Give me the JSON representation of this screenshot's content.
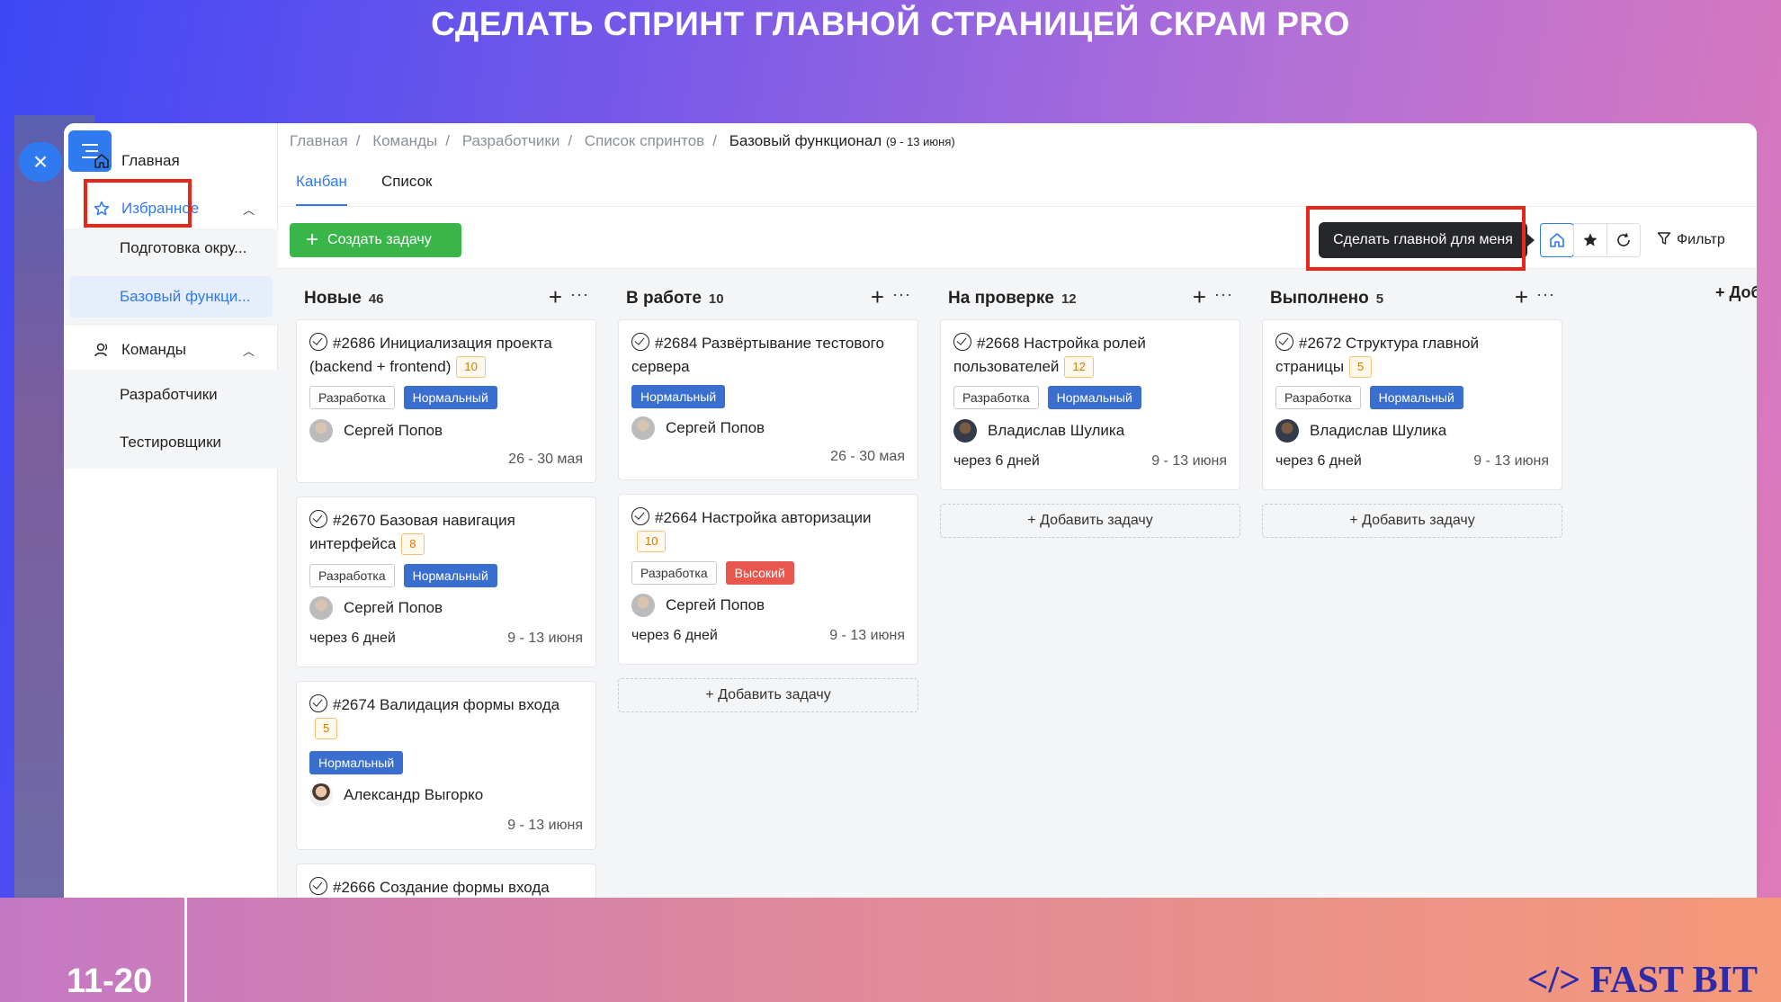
{
  "slide": {
    "title": "СДЕЛАТЬ СПРИНТ ГЛАВНОЙ СТРАНИЦЕЙ СКРАМ PRO",
    "page_number": "11-20",
    "brand": "</> FAST BIT"
  },
  "close_icon": "×",
  "sidebar": {
    "home": "Главная",
    "favorites": "Избранное",
    "favorites_items": [
      "Подготовка окру...",
      "Базовый функци..."
    ],
    "teams": "Команды",
    "teams_items": [
      "Разработчики",
      "Тестировщики"
    ]
  },
  "breadcrumb": {
    "items": [
      "Главная",
      "Команды",
      "Разработчики",
      "Список спринтов"
    ],
    "current": "Базовый функционал",
    "dates": "(9 - 13 июня)"
  },
  "tabs": [
    "Канбан",
    "Список"
  ],
  "toolbar": {
    "create_task": "Создать задачу",
    "tooltip": "Сделать главной для меня",
    "filter": "Фильтр"
  },
  "add_column": "+ Добавить",
  "add_task_label": "+ Добавить задачу",
  "columns": [
    {
      "title": "Новые",
      "count": "46",
      "cards": [
        {
          "id": "#2686",
          "title": "Инициализация проекта (backend + frontend)",
          "points": "10",
          "tags": [
            "Разработка",
            "Нормальный"
          ],
          "assignee": "Сергей Попов",
          "due_rel": "",
          "due": "26 - 30 мая"
        },
        {
          "id": "#2670",
          "title": "Базовая навигация интерфейса",
          "points": "8",
          "tags": [
            "Разработка",
            "Нормальный"
          ],
          "assignee": "Сергей Попов",
          "due_rel": "через 6 дней",
          "due": "9 - 13 июня"
        },
        {
          "id": "#2674",
          "title": "Валидация формы входа",
          "points": "5",
          "tags": [
            "Нормальный"
          ],
          "assignee": "Александр Выгорко",
          "due_rel": "",
          "due": "9 - 13 июня"
        },
        {
          "id": "#2666",
          "title": "Создание формы входа"
        }
      ]
    },
    {
      "title": "В работе",
      "count": "10",
      "cards": [
        {
          "id": "#2684",
          "title": "Развёртывание тестового сервера",
          "tags": [
            "Нормальный"
          ],
          "assignee": "Сергей Попов",
          "due_rel": "",
          "due": "26 - 30 мая"
        },
        {
          "id": "#2664",
          "title": "Настройка авторизации",
          "points": "10",
          "tags": [
            "Разработка",
            "Высокий"
          ],
          "assignee": "Сергей Попов",
          "due_rel": "через 6 дней",
          "due": "9 - 13 июня"
        }
      ]
    },
    {
      "title": "На проверке",
      "count": "12",
      "cards": [
        {
          "id": "#2668",
          "title": "Настройка ролей пользователей",
          "points": "12",
          "tags": [
            "Разработка",
            "Нормальный"
          ],
          "assignee": "Владислав Шулика",
          "due_rel": "через 6 дней",
          "due": "9 - 13 июня"
        }
      ]
    },
    {
      "title": "Выполнено",
      "count": "5",
      "cards": [
        {
          "id": "#2672",
          "title": "Структура главной страницы",
          "points": "5",
          "tags": [
            "Разработка",
            "Нормальный"
          ],
          "assignee": "Владислав Шулика",
          "due_rel": "через 6 дней",
          "due": "9 - 13 июня"
        }
      ]
    }
  ]
}
